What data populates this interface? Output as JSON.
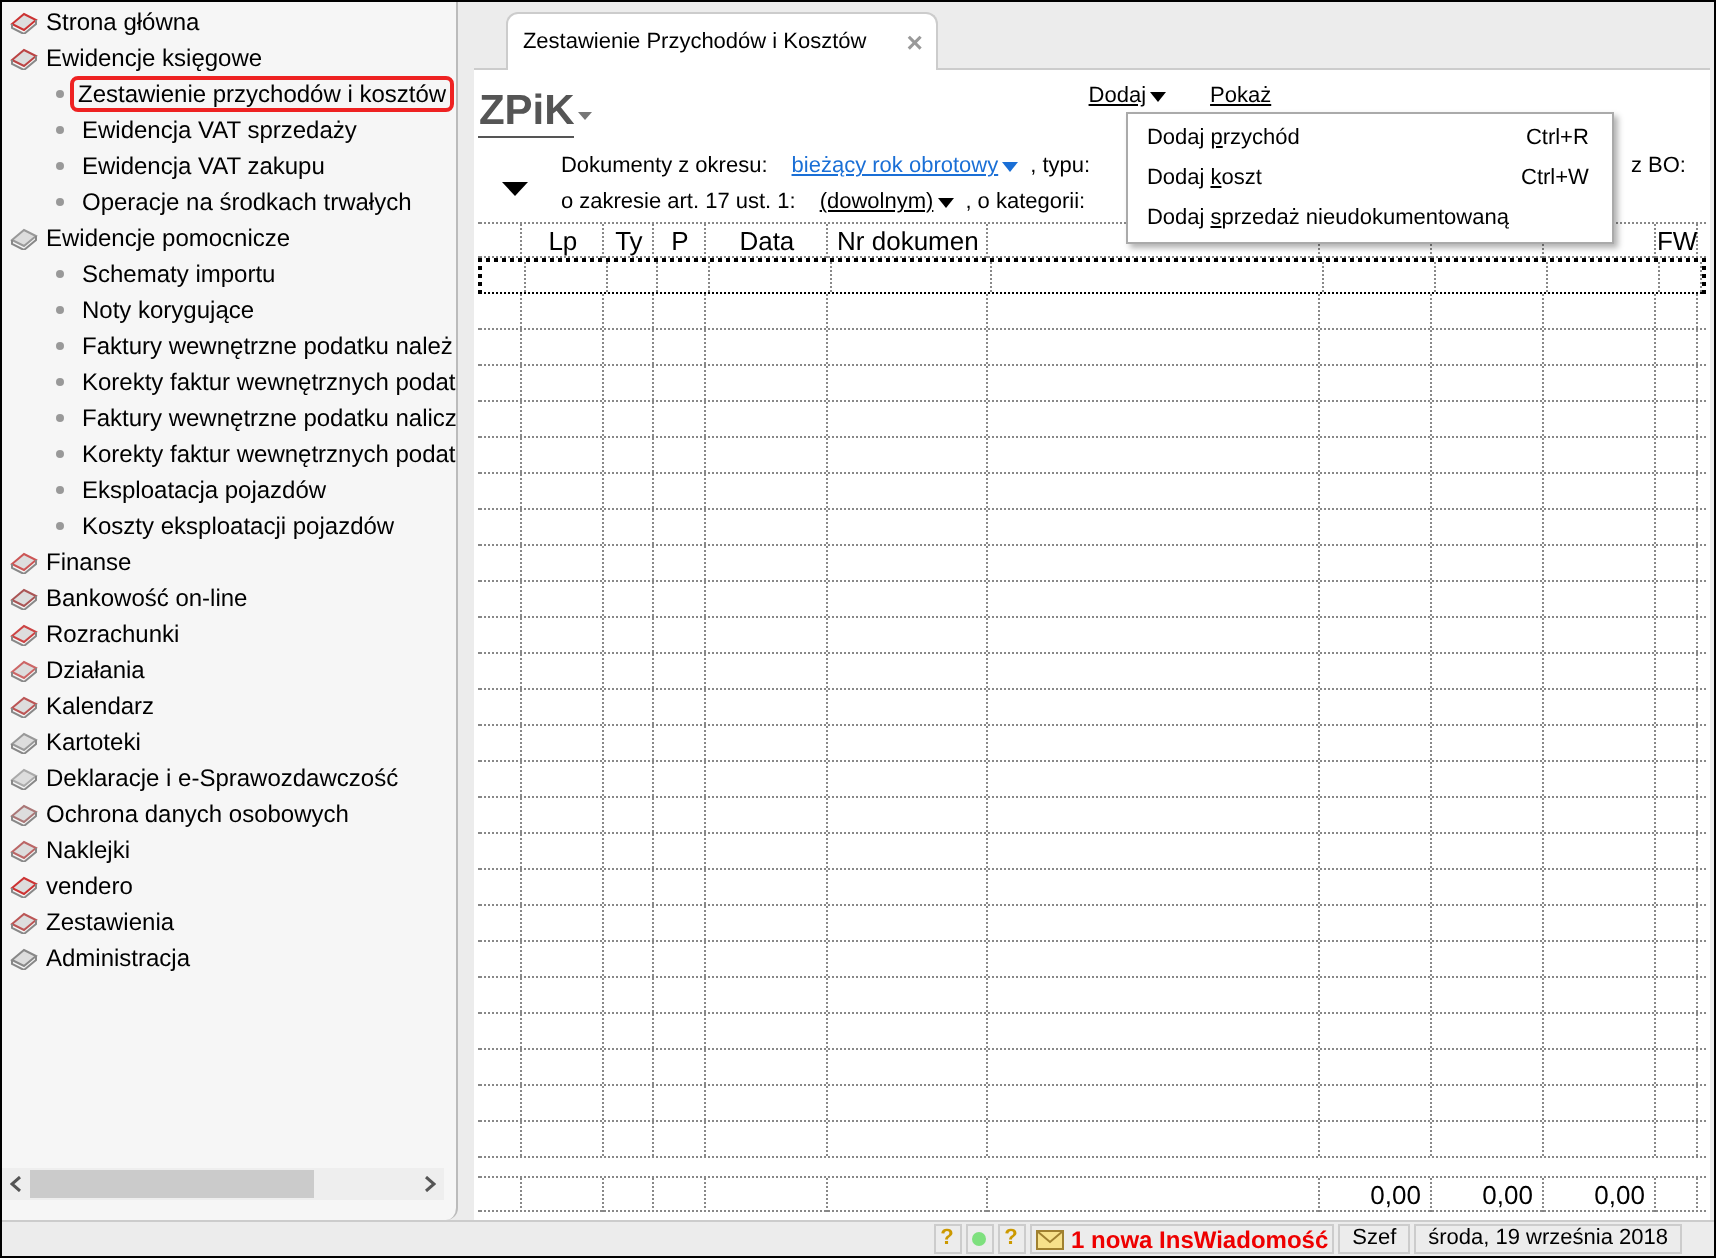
{
  "sidebar": {
    "items": [
      {
        "label": "Strona główna",
        "selected": false
      },
      {
        "label": "Ewidencje księgowe",
        "selected": false,
        "children": [
          {
            "label": "Zestawienie przychodów i kosztów",
            "selected": true
          },
          {
            "label": "Ewidencja VAT sprzedaży",
            "selected": false
          },
          {
            "label": "Ewidencja VAT zakupu",
            "selected": false
          },
          {
            "label": "Operacje na środkach trwałych",
            "selected": false
          }
        ]
      },
      {
        "label": "Ewidencje pomocnicze",
        "selected": false,
        "children": [
          {
            "label": "Schematy importu",
            "selected": false
          },
          {
            "label": "Noty korygujące",
            "selected": false
          },
          {
            "label": "Faktury wewnętrzne podatku należ",
            "selected": false
          },
          {
            "label": "Korekty faktur wewnętrznych podat",
            "selected": false
          },
          {
            "label": "Faktury wewnętrzne podatku nalicz",
            "selected": false
          },
          {
            "label": "Korekty faktur wewnętrznych podat",
            "selected": false
          },
          {
            "label": "Eksploatacja pojazdów",
            "selected": false
          },
          {
            "label": "Koszty eksploatacji pojazdów",
            "selected": false
          }
        ]
      },
      {
        "label": "Finanse",
        "selected": false
      },
      {
        "label": "Bankowość on-line",
        "selected": false
      },
      {
        "label": "Rozrachunki",
        "selected": false
      },
      {
        "label": "Działania",
        "selected": false
      },
      {
        "label": "Kalendarz",
        "selected": false
      },
      {
        "label": "Kartoteki",
        "selected": false
      },
      {
        "label": "Deklaracje i e-Sprawozdawczość",
        "selected": false
      },
      {
        "label": "Ochrona danych osobowych",
        "selected": false
      },
      {
        "label": "Naklejki",
        "selected": false
      },
      {
        "label": "vendero",
        "selected": false
      },
      {
        "label": "Zestawienia",
        "selected": false
      },
      {
        "label": "Administracja",
        "selected": false
      }
    ]
  },
  "tab": {
    "title": "Zestawienie Przychodów i Kosztów",
    "close": "×"
  },
  "heading": "ZPiK",
  "actions": [
    {
      "label": "Dodaj",
      "dropdown": true
    },
    {
      "label": "Pokaż",
      "dropdown": false
    }
  ],
  "menu": [
    {
      "pre": "Dodaj ",
      "key": "p",
      "post": "rzychód",
      "shortcut": "Ctrl+R"
    },
    {
      "pre": "Dodaj ",
      "key": "k",
      "post": "oszt",
      "shortcut": "Ctrl+W"
    },
    {
      "pre": "Dodaj ",
      "key": "s",
      "post": "przedaż nieudokumentowaną"
    }
  ],
  "filters": {
    "period_label": "Dokumenty z okresu:",
    "period_value": "bieżący rok obrotowy",
    "type_label": ", typu:",
    "scope_label": "o zakresie art. 17 ust. 1:",
    "scope_value": "(dowolnym)",
    "category_label": ", o kategorii:",
    "bo_label": "z BO:"
  },
  "table": {
    "columns": [
      "Lp",
      "Ty",
      "P",
      "Data",
      "Nr dokumen",
      "FW"
    ],
    "totals": [
      "0,00",
      "0,00",
      "0,00"
    ]
  },
  "status_bar": {
    "help": "?",
    "help2": "?",
    "message": "1 nowa InsWiadomość",
    "user": "Szef",
    "date": "środa, 19 września 2018"
  }
}
